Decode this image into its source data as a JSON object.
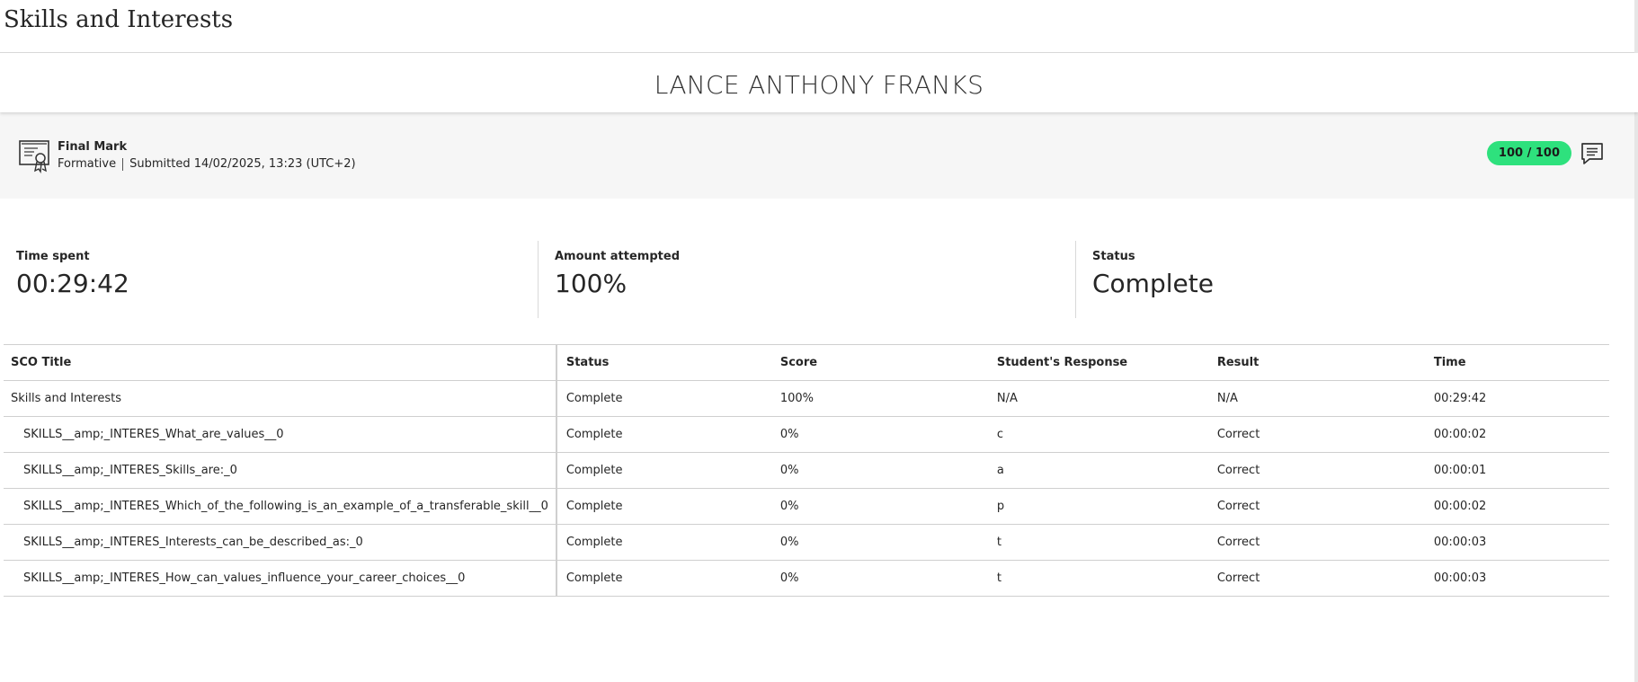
{
  "page": {
    "title": "Skills and Interests"
  },
  "student": {
    "name": "LANCE ANTHONY FRANKS"
  },
  "grade": {
    "label": "Final Mark",
    "type": "Formative",
    "submitted": "Submitted 14/02/2025, 13:23 (UTC+2)",
    "score": "100 / 100",
    "score_color": "#2ee17d",
    "icon": "certificate-icon",
    "feedback_icon": "feedback-comment-icon"
  },
  "summary": {
    "time_spent_label": "Time spent",
    "time_spent_value": "00:29:42",
    "attempted_label": "Amount attempted",
    "attempted_value": "100%",
    "status_label": "Status",
    "status_value": "Complete"
  },
  "table": {
    "headers": [
      "SCO Title",
      "Status",
      "Score",
      "Student's Response",
      "Result",
      "Time"
    ],
    "rows": [
      [
        "Skills and Interests",
        "Complete",
        "100%",
        "N/A",
        "N/A",
        "00:29:42"
      ],
      [
        "SKILLS__amp;_INTERES_What_are_values__0",
        "Complete",
        "0%",
        "c",
        "Correct",
        "00:00:02"
      ],
      [
        "SKILLS__amp;_INTERES_Skills_are:_0",
        "Complete",
        "0%",
        "a",
        "Correct",
        "00:00:01"
      ],
      [
        "SKILLS__amp;_INTERES_Which_of_the_following_is_an_example_of_a_transferable_skill__0",
        "Complete",
        "0%",
        "p",
        "Correct",
        "00:00:02"
      ],
      [
        "SKILLS__amp;_INTERES_Interests_can_be_described_as:_0",
        "Complete",
        "0%",
        "t",
        "Correct",
        "00:00:03"
      ],
      [
        "SKILLS__amp;_INTERES_How_can_values_influence_your_career_choices__0",
        "Complete",
        "0%",
        "t",
        "Correct",
        "00:00:03"
      ]
    ]
  }
}
